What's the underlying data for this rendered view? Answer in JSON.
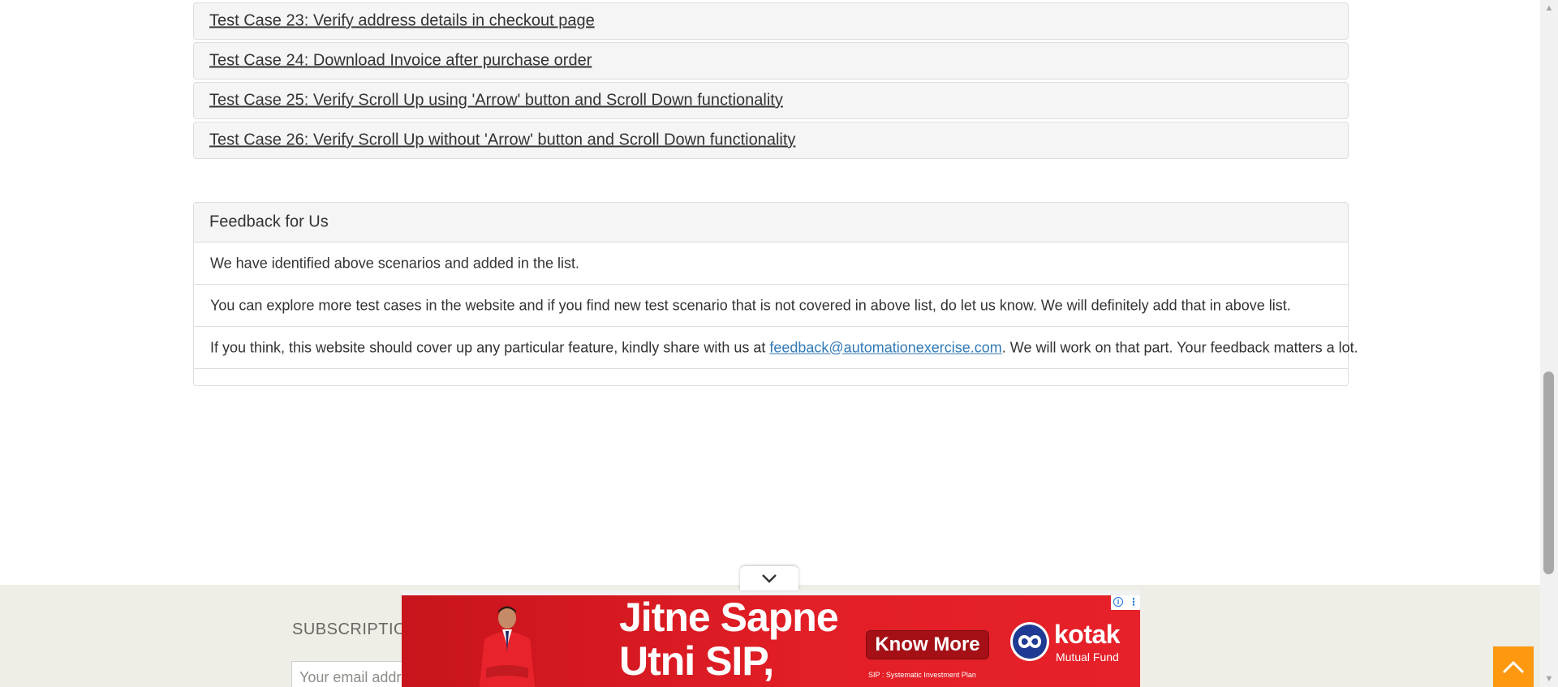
{
  "test_cases": [
    {
      "label": "Test Case 23: Verify address details in checkout page"
    },
    {
      "label": "Test Case 24: Download Invoice after purchase order"
    },
    {
      "label": "Test Case 25: Verify Scroll Up using 'Arrow' button and Scroll Down functionality"
    },
    {
      "label": "Test Case 26: Verify Scroll Up without 'Arrow' button and Scroll Down functionality"
    }
  ],
  "feedback": {
    "title": "Feedback for Us",
    "line1": "We have identified above scenarios and added in the list.",
    "line2": "You can explore more test cases in the website and if you find new test scenario that is not covered in above list, do let us know. We will definitely add that in above list.",
    "line3_before": "If you think, this website should cover up any particular feature, kindly share with us at ",
    "email": "feedback@automationexercise.com",
    "line3_after": ". We will work on that part. Your feedback matters a lot."
  },
  "footer": {
    "subscription_title": "SUBSCRIPTION",
    "email_placeholder": "Your email address"
  },
  "ad": {
    "headline_line1": "Jitne Sapne",
    "headline_line2": "Utni SIP,",
    "button_label": "Know More",
    "note": "SIP : Systematic Investment Plan",
    "brand": "kotak",
    "brand_sub": "Mutual Fund"
  },
  "colors": {
    "panel_bg": "#f5f5f5",
    "footer_bg": "#eeeee6",
    "scroll_up_bg": "#fe980f",
    "ad_red": "#e21e26",
    "link_blue": "#337ab7"
  }
}
